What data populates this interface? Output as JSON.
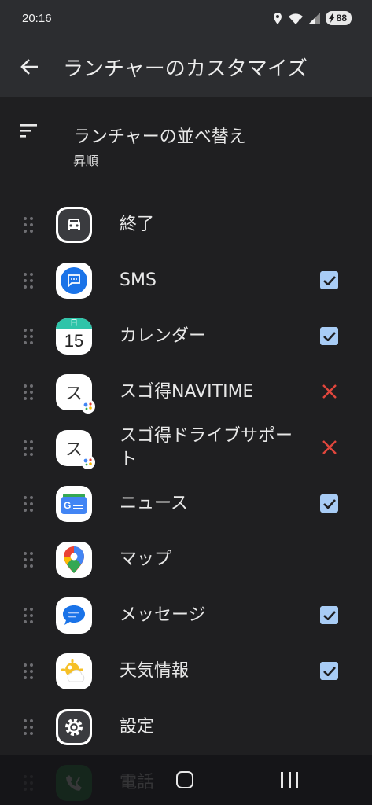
{
  "status_bar": {
    "time": "20:16",
    "battery": "88"
  },
  "header": {
    "title": "ランチャーのカスタマイズ"
  },
  "sort": {
    "title": "ランチャーの並べ替え",
    "value": "昇順"
  },
  "apps": [
    {
      "name": "終了",
      "icon": "car-icon",
      "state": "none"
    },
    {
      "name": "SMS",
      "icon": "sms-icon",
      "state": "checked"
    },
    {
      "name": "カレンダー",
      "icon": "calendar-icon",
      "calendar_day": "15",
      "calendar_header": "日",
      "state": "checked"
    },
    {
      "name": "スゴ得NAVITIME",
      "icon": "sugotoku-icon",
      "icon_glyph": "ス",
      "state": "removed"
    },
    {
      "name": "スゴ得ドライブサポー\nト",
      "name_line1": "スゴ得ドライブサポー",
      "name_line2": "ト",
      "icon": "sugotoku-icon",
      "icon_glyph": "ス",
      "state": "removed"
    },
    {
      "name": "ニュース",
      "icon": "news-icon",
      "icon_glyph": "G",
      "state": "checked"
    },
    {
      "name": "マップ",
      "icon": "maps-icon",
      "state": "none"
    },
    {
      "name": "メッセージ",
      "icon": "messages-icon",
      "state": "checked"
    },
    {
      "name": "天気情報",
      "icon": "weather-icon",
      "state": "checked"
    },
    {
      "name": "設定",
      "icon": "settings-gear-icon",
      "state": "none"
    },
    {
      "name": "電話",
      "icon": "phone-icon",
      "state": "none"
    }
  ],
  "colors": {
    "background": "#1f1f21",
    "bar": "#2c2d30",
    "checkbox": "#a8ccf5",
    "remove": "#e0463c"
  }
}
